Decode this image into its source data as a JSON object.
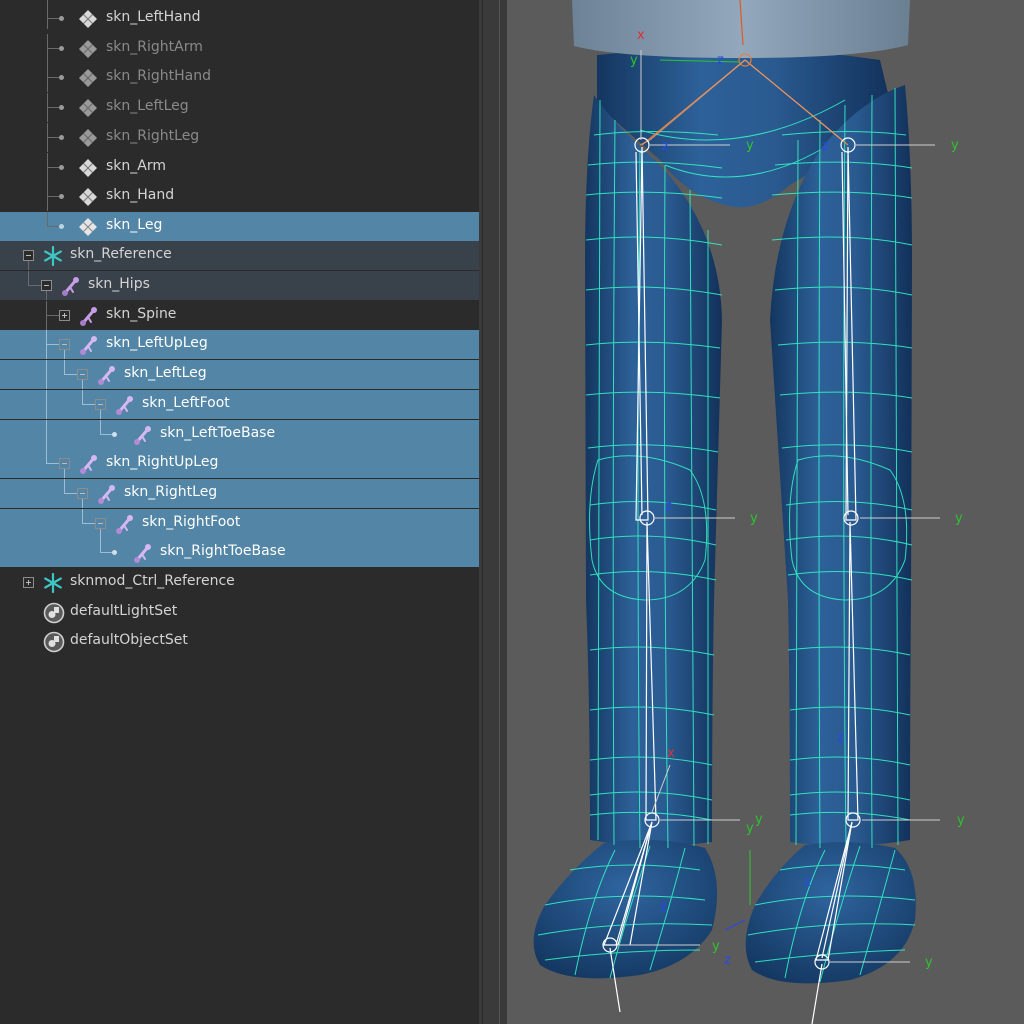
{
  "outliner": {
    "items": [
      {
        "label": "skn_LeftHand",
        "icon": "mesh-icon",
        "dim": false
      },
      {
        "label": "skn_RightArm",
        "icon": "mesh-icon",
        "dim": true
      },
      {
        "label": "skn_RightHand",
        "icon": "mesh-icon",
        "dim": true
      },
      {
        "label": "skn_LeftLeg",
        "icon": "mesh-icon",
        "dim": true
      },
      {
        "label": "skn_RightLeg",
        "icon": "mesh-icon",
        "dim": true
      },
      {
        "label": "skn_Arm",
        "icon": "mesh-icon",
        "dim": false
      },
      {
        "label": "skn_Hand",
        "icon": "mesh-icon",
        "dim": false
      },
      {
        "label": "skn_Leg",
        "icon": "mesh-icon",
        "selected": true
      },
      {
        "label": "skn_Reference",
        "icon": "reference-icon",
        "expanded": true
      },
      {
        "label": "skn_Hips",
        "icon": "joint-icon",
        "expanded": true
      },
      {
        "label": "skn_Spine",
        "icon": "joint-icon",
        "expanded": false
      },
      {
        "label": "skn_LeftUpLeg",
        "icon": "joint-icon",
        "selected": true,
        "expanded": true
      },
      {
        "label": "skn_LeftLeg",
        "icon": "joint-icon",
        "selected": true,
        "expanded": true
      },
      {
        "label": "skn_LeftFoot",
        "icon": "joint-icon",
        "selected": true,
        "expanded": true
      },
      {
        "label": "skn_LeftToeBase",
        "icon": "joint-icon",
        "selected": true
      },
      {
        "label": "skn_RightUpLeg",
        "icon": "joint-icon",
        "selected": true,
        "expanded": true
      },
      {
        "label": "skn_RightLeg",
        "icon": "joint-icon",
        "selected": true,
        "expanded": true
      },
      {
        "label": "skn_RightFoot",
        "icon": "joint-icon",
        "selected": true,
        "expanded": true
      },
      {
        "label": "skn_RightToeBase",
        "icon": "joint-icon",
        "selected": true
      },
      {
        "label": "sknmod_Ctrl_Reference",
        "icon": "reference-icon",
        "expanded": false
      },
      {
        "label": "defaultLightSet",
        "icon": "set-icon"
      },
      {
        "label": "defaultObjectSet",
        "icon": "set-icon"
      }
    ]
  },
  "viewport": {
    "axis_labels": {
      "x": "x",
      "y": "y",
      "z": "z"
    },
    "colors": {
      "background": "#5b5b5b",
      "mesh": "#1f4a7a",
      "wireframe": "#33ffcc",
      "bone": "#ffffff",
      "x_axis": "#e03030",
      "y_axis": "#2ec42e",
      "z_axis": "#2a48e8",
      "shirt": "#8fa4b8"
    }
  }
}
